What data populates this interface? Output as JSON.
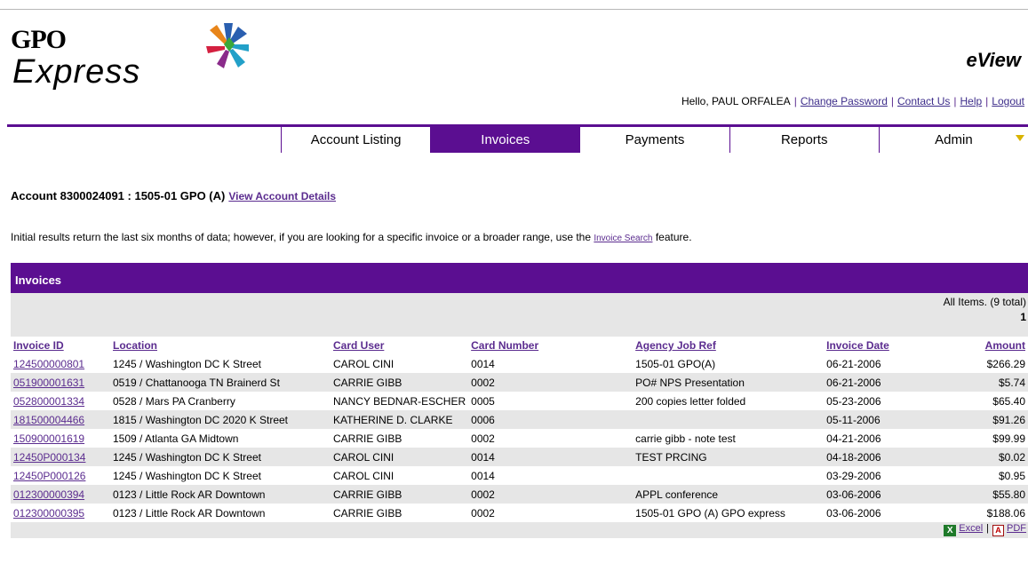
{
  "logo": {
    "line1": "GPO",
    "line2": "Express"
  },
  "brand": "eView",
  "user": {
    "greeting": "Hello, PAUL ORFALEA",
    "links": [
      "Change Password",
      "Contact Us",
      "Help",
      "Logout"
    ]
  },
  "nav": {
    "tabs": [
      "Account Listing",
      "Invoices",
      "Payments",
      "Reports",
      "Admin"
    ],
    "active": "Invoices"
  },
  "account": {
    "title": "Account 8300024091 : 1505-01 GPO (A)",
    "details_link": "View Account Details"
  },
  "intro": {
    "before": "Initial results return the last six months of data; however, if you are looking for a specific invoice or a broader range, use the ",
    "link": "Invoice Search",
    "after": " feature."
  },
  "invoices": {
    "heading": "Invoices",
    "count_label": "All Items. (9 total)",
    "page": "1",
    "columns": [
      "Invoice ID",
      "Location",
      "Card User",
      "Card Number",
      "Agency Job Ref",
      "Invoice Date",
      "Amount"
    ],
    "rows": [
      [
        "124500000801",
        "1245 / Washington DC K Street",
        "CAROL CINI",
        "0014",
        "1505-01 GPO(A)",
        "06-21-2006",
        "$266.29"
      ],
      [
        "051900001631",
        "0519 / Chattanooga TN Brainerd St",
        "CARRIE GIBB",
        "0002",
        "PO# NPS Presentation",
        "06-21-2006",
        "$5.74"
      ],
      [
        "052800001334",
        "0528 / Mars PA Cranberry",
        "NANCY BEDNAR-ESCHER",
        "0005",
        "200 copies letter folded",
        "05-23-2006",
        "$65.40"
      ],
      [
        "181500004466",
        "1815 / Washington DC 2020 K Street",
        "KATHERINE D. CLARKE",
        "0006",
        "",
        "05-11-2006",
        "$91.26"
      ],
      [
        "150900001619",
        "1509 / Atlanta GA Midtown",
        "CARRIE GIBB",
        "0002",
        "carrie gibb - note test",
        "04-21-2006",
        "$99.99"
      ],
      [
        "12450P000134",
        "1245 / Washington DC K Street",
        "CAROL CINI",
        "0014",
        "TEST PRCING",
        "04-18-2006",
        "$0.02"
      ],
      [
        "12450P000126",
        "1245 / Washington DC K Street",
        "CAROL CINI",
        "0014",
        "",
        "03-29-2006",
        "$0.95"
      ],
      [
        "012300000394",
        "0123 / Little Rock AR Downtown",
        "CARRIE GIBB",
        "0002",
        "APPL conference",
        "03-06-2006",
        "$55.80"
      ],
      [
        "012300000395",
        "0123 / Little Rock AR Downtown",
        "CARRIE GIBB",
        "0002",
        "1505-01 GPO (A) GPO express",
        "03-06-2006",
        "$188.06"
      ]
    ]
  },
  "exports": {
    "excel": "Excel",
    "pdf": "PDF"
  },
  "colors": {
    "primary": "#5b0e91",
    "link": "#5b2c8f",
    "row_alt": "#e6e6e6"
  }
}
